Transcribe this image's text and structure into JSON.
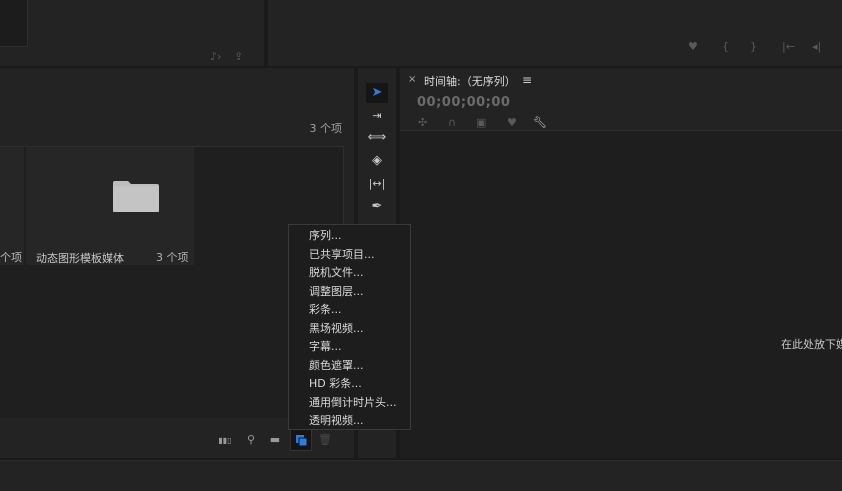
{
  "project": {
    "item_count": "3 个项",
    "tiles": [
      {
        "label": "个项"
      },
      {
        "label": "动态图形模板媒体",
        "count": "3 个项"
      }
    ]
  },
  "timeline": {
    "tab_label": "时间轴:（无序列）",
    "close_glyph": "×",
    "menu_glyph": "≡",
    "timecode": "00;00;00;00",
    "drop_hint": "在此处放下媒"
  },
  "context_menu": {
    "items": [
      "序列...",
      "已共享项目...",
      "脱机文件...",
      "调整图层...",
      "彩条...",
      "黑场视频...",
      "字幕...",
      "颜色遮罩...",
      "HD 彩条...",
      "通用倒计时片头...",
      "透明视频..."
    ]
  },
  "icons": {
    "accent": "#2e7ce0"
  }
}
